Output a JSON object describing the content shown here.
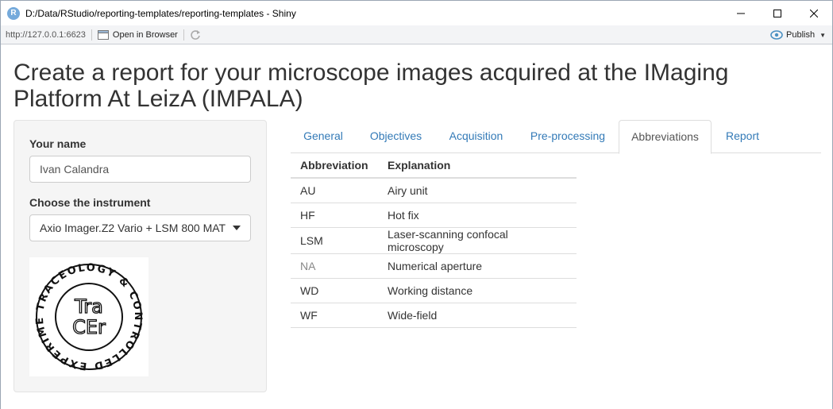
{
  "window": {
    "title": "D:/Data/RStudio/reporting-templates/reporting-templates - Shiny",
    "app_icon_letter": "R"
  },
  "toolbar": {
    "url": "http://127.0.0.1:6623",
    "open_in_browser": "Open in Browser",
    "publish": "Publish"
  },
  "page": {
    "title": "Create a report for your microscope images acquired at the IMaging Platform At LeizA (IMPALA)"
  },
  "sidebar": {
    "name_label": "Your name",
    "name_value": "Ivan Calandra",
    "instrument_label": "Choose the instrument",
    "instrument_value": "Axio Imager.Z2 Vario + LSM 800 MAT",
    "logo": {
      "ring_text": "TRACEOLOGY & CONTROLLED EXPERIMENTS",
      "center_top": "Tra",
      "center_bottom": "CEr"
    }
  },
  "tabs": [
    {
      "label": "General",
      "active": false
    },
    {
      "label": "Objectives",
      "active": false
    },
    {
      "label": "Acquisition",
      "active": false
    },
    {
      "label": "Pre-processing",
      "active": false
    },
    {
      "label": "Abbreviations",
      "active": true
    },
    {
      "label": "Report",
      "active": false
    }
  ],
  "table": {
    "headers": [
      "Abbreviation",
      "Explanation"
    ],
    "rows": [
      [
        "AU",
        "Airy unit"
      ],
      [
        "HF",
        "Hot fix"
      ],
      [
        "LSM",
        "Laser-scanning confocal microscopy"
      ],
      [
        "NA",
        "Numerical aperture"
      ],
      [
        "WD",
        "Working distance"
      ],
      [
        "WF",
        "Wide-field"
      ]
    ]
  },
  "colors": {
    "link": "#337ab7",
    "r_icon": "#75aadb",
    "publish_icon": "#4a90c2"
  }
}
